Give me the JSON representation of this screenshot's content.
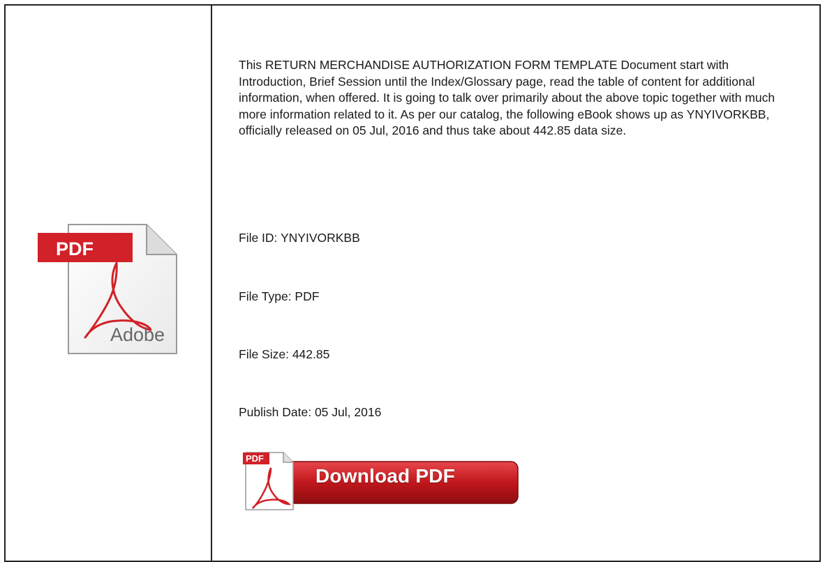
{
  "document": {
    "description": "This RETURN MERCHANDISE AUTHORIZATION FORM TEMPLATE Document start with Introduction, Brief Session until the Index/Glossary page, read the table of content for additional information, when offered. It is going to talk over primarily about the above topic together with much more information related to it. As per our catalog, the following eBook shows up as YNYIVORKBB, officially released on 05 Jul, 2016 and thus take about 442.85 data size.",
    "file_id": "File ID: YNYIVORKBB",
    "file_type": "File Type: PDF",
    "file_size": "File Size: 442.85",
    "publish_date": "Publish Date: 05 Jul, 2016"
  },
  "icon": {
    "badge_text": "PDF",
    "brand_text": "Adobe",
    "badge_color": "#d22128"
  },
  "download": {
    "label": "Download PDF",
    "badge_text": "PDF",
    "button_color": "#c0171c"
  }
}
